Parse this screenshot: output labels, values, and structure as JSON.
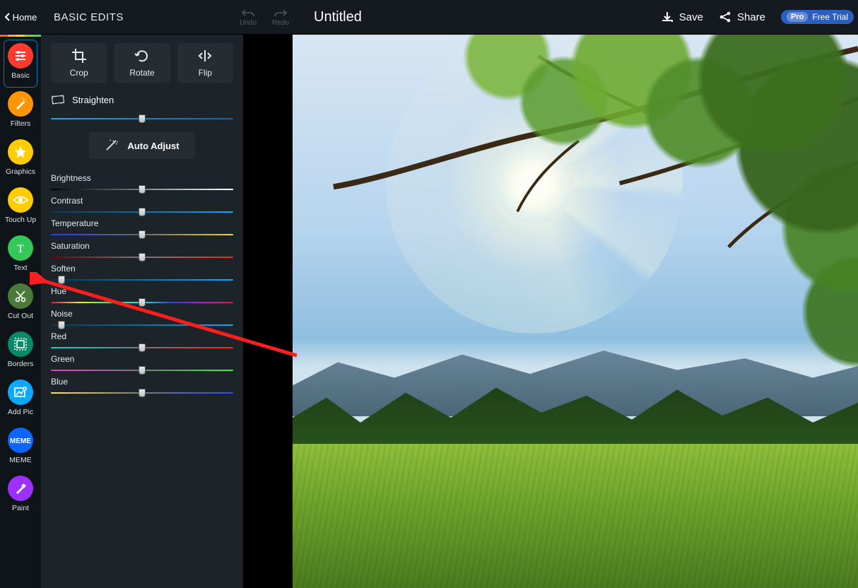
{
  "colors": {
    "nav": {
      "basic": "#ff3b30",
      "filters": "#ff9500",
      "graphics": "#ffcc00",
      "touchup": "#ffcc00",
      "text": "#34c759",
      "cutout": "#4a7a3a",
      "borders": "#0b8a6a",
      "addpic": "#0aa8ff",
      "meme": "#0a66ff",
      "paint": "#9b30ff"
    }
  },
  "topbar": {
    "home": "Home",
    "panel_title": "BASIC EDITS",
    "undo": "Undo",
    "redo": "Redo",
    "doc_title": "Untitled",
    "save": "Save",
    "share": "Share",
    "pro_badge": "Pro",
    "pro_text": "Free Trial"
  },
  "nav": [
    {
      "id": "basic",
      "label": "Basic",
      "active": true
    },
    {
      "id": "filters",
      "label": "Filters"
    },
    {
      "id": "graphics",
      "label": "Graphics"
    },
    {
      "id": "touchup",
      "label": "Touch Up"
    },
    {
      "id": "text",
      "label": "Text"
    },
    {
      "id": "cutout",
      "label": "Cut Out"
    },
    {
      "id": "borders",
      "label": "Borders"
    },
    {
      "id": "addpic",
      "label": "Add Pic"
    },
    {
      "id": "meme",
      "label": "MEME"
    },
    {
      "id": "paint",
      "label": "Paint"
    }
  ],
  "tools": {
    "crop": "Crop",
    "rotate": "Rotate",
    "flip": "Flip",
    "straighten": "Straighten",
    "auto": "Auto Adjust"
  },
  "sliders": [
    {
      "id": "straighten",
      "label": "",
      "pos": 50,
      "grad": "linear-gradient(90deg,#0aa8ff,#0a66a8)",
      "attached_to": "straighten_row"
    },
    {
      "id": "brightness",
      "label": "Brightness",
      "pos": 50,
      "grad": "linear-gradient(90deg,#000,#fff)"
    },
    {
      "id": "contrast",
      "label": "Contrast",
      "pos": 50,
      "grad": "linear-gradient(90deg,#063a52,#0aa8ff)"
    },
    {
      "id": "temperature",
      "label": "Temperature",
      "pos": 50,
      "grad": "linear-gradient(90deg,#1e3fff,#6a6a6a 50%,#ffd400)"
    },
    {
      "id": "saturation",
      "label": "Saturation",
      "pos": 50,
      "grad": "linear-gradient(90deg,#7a0000,#777 50%,#ff1e1e)"
    },
    {
      "id": "soften",
      "label": "Soften",
      "pos": 6,
      "grad": "linear-gradient(90deg,#063a52,#0aa8ff)"
    },
    {
      "id": "hue",
      "label": "Hue",
      "pos": 50,
      "grad": "linear-gradient(90deg,#ff0040,#ffef00 16%,#00ff40 33%,#00f0ff 50%,#2040ff 66%,#d400ff 83%,#ff0040)"
    },
    {
      "id": "noise",
      "label": "Noise",
      "pos": 6,
      "grad": "linear-gradient(90deg,#063a52,#0aa8ff)"
    },
    {
      "id": "red",
      "label": "Red",
      "pos": 50,
      "grad": "linear-gradient(90deg,#00d6d6,#777 50%,#ff1e1e)"
    },
    {
      "id": "green",
      "label": "Green",
      "pos": 50,
      "grad": "linear-gradient(90deg,#e83ccf,#777 50%,#2bff2b)"
    },
    {
      "id": "blue",
      "label": "Blue",
      "pos": 50,
      "grad": "linear-gradient(90deg,#ffe24a,#777 50%,#2b4bff)"
    }
  ]
}
